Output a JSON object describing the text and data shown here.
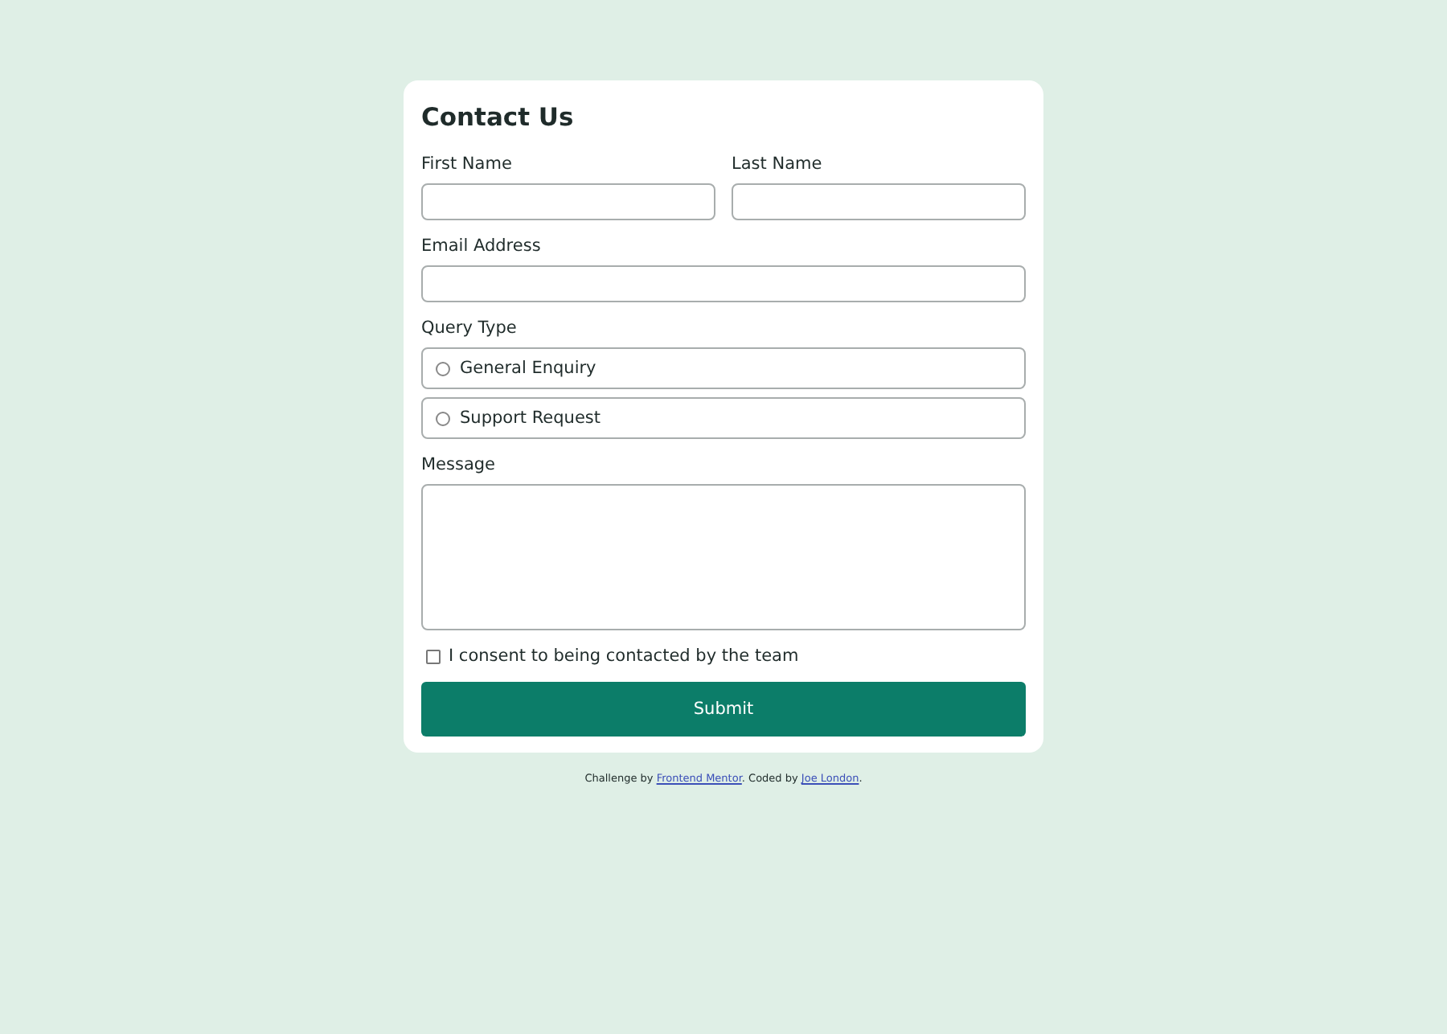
{
  "form": {
    "title": "Contact Us",
    "name_fields": [
      {
        "label": "First Name"
      },
      {
        "label": "Last Name"
      }
    ],
    "email": {
      "label": "Email Address"
    },
    "query_type": {
      "label": "Query Type",
      "options": [
        {
          "label": "General Enquiry",
          "selected": false
        },
        {
          "label": "Support Request",
          "selected": false
        }
      ]
    },
    "message": {
      "label": "Message"
    },
    "consent": {
      "label": "I consent to being contacted by the team",
      "checked": false
    },
    "submit": "Submit"
  },
  "attribution": [
    {
      "kind": "text",
      "text": "Challenge by "
    },
    {
      "kind": "link",
      "text": "Frontend Mentor"
    },
    {
      "kind": "text",
      "text": ". Coded by "
    },
    {
      "kind": "link",
      "text": "Joe London"
    },
    {
      "kind": "text",
      "text": "."
    }
  ]
}
